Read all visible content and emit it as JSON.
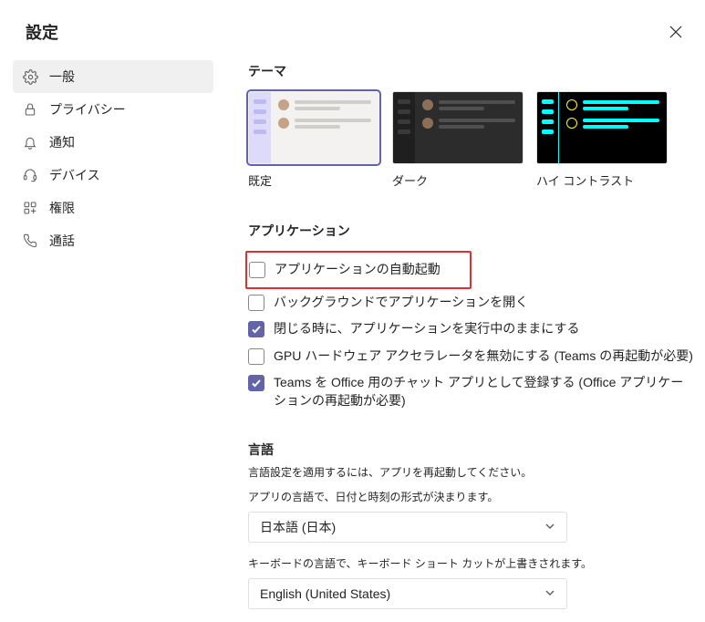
{
  "title": "設定",
  "sidebar": {
    "items": [
      {
        "label": "一般"
      },
      {
        "label": "プライバシー"
      },
      {
        "label": "通知"
      },
      {
        "label": "デバイス"
      },
      {
        "label": "権限"
      },
      {
        "label": "通話"
      }
    ]
  },
  "theme": {
    "heading": "テーマ",
    "options": [
      {
        "label": "既定"
      },
      {
        "label": "ダーク"
      },
      {
        "label": "ハイ コントラスト"
      }
    ]
  },
  "application": {
    "heading": "アプリケーション",
    "items": [
      {
        "label": "アプリケーションの自動起動"
      },
      {
        "label": "バックグラウンドでアプリケーションを開く"
      },
      {
        "label": "閉じる時に、アプリケーションを実行中のままにする"
      },
      {
        "label": "GPU ハードウェア アクセラレータを無効にする (Teams の再起動が必要)"
      },
      {
        "label": "Teams を Office 用のチャット アプリとして登録する (Office アプリケーションの再起動が必要)"
      }
    ]
  },
  "language": {
    "heading": "言語",
    "hint": "言語設定を適用するには、アプリを再起動してください。",
    "app_label": "アプリの言語で、日付と時刻の形式が決まります。",
    "app_value": "日本語 (日本)",
    "kb_label": "キーボードの言語で、キーボード ショート カットが上書きされます。",
    "kb_value": "English (United States)"
  }
}
